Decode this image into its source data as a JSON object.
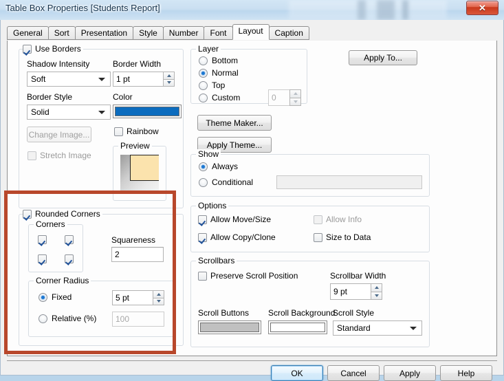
{
  "window": {
    "title": "Table Box Properties [Students Report]",
    "close_label": "x",
    "close_icon": "close-icon"
  },
  "tabs": [
    {
      "label": "General",
      "active": false
    },
    {
      "label": "Sort",
      "active": false
    },
    {
      "label": "Presentation",
      "active": false
    },
    {
      "label": "Style",
      "active": false
    },
    {
      "label": "Number",
      "active": false
    },
    {
      "label": "Font",
      "active": false
    },
    {
      "label": "Layout",
      "active": true
    },
    {
      "label": "Caption",
      "active": false
    }
  ],
  "borders": {
    "group_label": "Use Borders",
    "use_borders_checked": true,
    "shadow_intensity_label": "Shadow Intensity",
    "shadow_intensity_value": "Soft",
    "border_width_label": "Border Width",
    "border_width_value": "1 pt",
    "border_style_label": "Border Style",
    "border_style_value": "Solid",
    "color_label": "Color",
    "color_value": "#0c6cbe",
    "change_image_label": "Change Image...",
    "change_image_enabled": false,
    "stretch_image_label": "Stretch Image",
    "stretch_image_checked": false,
    "stretch_image_enabled": false,
    "rainbow_label": "Rainbow",
    "rainbow_checked": false,
    "preview_label": "Preview",
    "preview_fill": "#fbe3ad"
  },
  "rounded": {
    "group_label": "Rounded Corners",
    "checked": true,
    "corners_label": "Corners",
    "corners": [
      {
        "name": "top-left",
        "checked": true
      },
      {
        "name": "top-right",
        "checked": true
      },
      {
        "name": "bottom-left",
        "checked": true
      },
      {
        "name": "bottom-right",
        "checked": true
      }
    ],
    "squareness_label": "Squareness",
    "squareness_value": "2",
    "corner_radius_label": "Corner Radius",
    "fixed_label": "Fixed",
    "fixed_selected": true,
    "fixed_value": "5 pt",
    "relative_label": "Relative (%)",
    "relative_selected": false,
    "relative_value": "100"
  },
  "layer": {
    "group_label": "Layer",
    "options": [
      {
        "label": "Bottom",
        "selected": false
      },
      {
        "label": "Normal",
        "selected": true
      },
      {
        "label": "Top",
        "selected": false
      },
      {
        "label": "Custom",
        "selected": false
      }
    ],
    "custom_value": "0",
    "custom_enabled": false
  },
  "theme": {
    "theme_maker_label": "Theme Maker...",
    "apply_theme_label": "Apply Theme..."
  },
  "show": {
    "group_label": "Show",
    "always_label": "Always",
    "always_selected": true,
    "conditional_label": "Conditional",
    "conditional_selected": false,
    "conditional_value": "",
    "conditional_enabled": false
  },
  "options": {
    "group_label": "Options",
    "items": [
      {
        "label": "Allow Move/Size",
        "checked": true,
        "enabled": true
      },
      {
        "label": "Allow Info",
        "checked": false,
        "enabled": false
      },
      {
        "label": "Allow Copy/Clone",
        "checked": true,
        "enabled": true
      },
      {
        "label": "Size to Data",
        "checked": false,
        "enabled": true
      }
    ]
  },
  "scrollbars": {
    "group_label": "Scrollbars",
    "preserve_label": "Preserve Scroll Position",
    "preserve_checked": false,
    "width_label": "Scrollbar Width",
    "width_value": "9 pt",
    "scroll_buttons_label": "Scroll Buttons",
    "scroll_buttons_color": "#c0c0c0",
    "scroll_background_label": "Scroll Background",
    "scroll_background_color": "#ffffff",
    "scroll_style_label": "Scroll Style",
    "scroll_style_value": "Standard"
  },
  "apply_to": {
    "label": "Apply To..."
  },
  "footer": {
    "ok_label": "OK",
    "cancel_label": "Cancel",
    "apply_label": "Apply",
    "help_label": "Help"
  },
  "annotation": {
    "color": "#b8472b",
    "target": "rounded-corners-section"
  }
}
